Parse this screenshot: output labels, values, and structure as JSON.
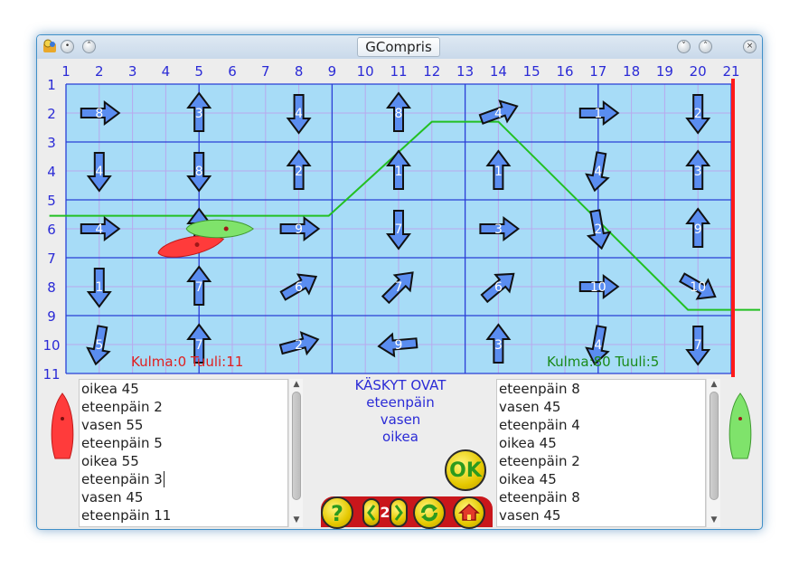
{
  "window": {
    "title": "GCompris"
  },
  "colors": {
    "sea": "#a7dcf7",
    "grid_major": "#2a3fd6",
    "grid_minor": "#b8a9ee",
    "arrow_fill": "#5a8df0",
    "axis_label": "#2b2bd6",
    "finish_line": "#ff1b1b",
    "boat_red": "#ff3b3b",
    "boat_green": "#7fe36b",
    "track_green": "#22c022",
    "text_red": "#e02020",
    "text_green": "#1a8a1a"
  },
  "board": {
    "x_labels": [
      "1",
      "2",
      "3",
      "4",
      "5",
      "6",
      "7",
      "8",
      "9",
      "10",
      "11",
      "12",
      "13",
      "14",
      "15",
      "16",
      "17",
      "18",
      "19",
      "20",
      "21"
    ],
    "y_labels": [
      "1",
      "2",
      "3",
      "4",
      "5",
      "6",
      "7",
      "8",
      "9",
      "10",
      "11"
    ],
    "arrows": [
      {
        "label": "8",
        "dir": 90,
        "col": 2,
        "row": 2
      },
      {
        "label": "3",
        "dir": 0,
        "col": 5,
        "row": 2
      },
      {
        "label": "4",
        "dir": 180,
        "col": 8,
        "row": 2
      },
      {
        "label": "8",
        "dir": 0,
        "col": 11,
        "row": 2
      },
      {
        "label": "4",
        "dir": 70,
        "col": 14,
        "row": 2
      },
      {
        "label": "1",
        "dir": 90,
        "col": 17,
        "row": 2
      },
      {
        "label": "2",
        "dir": 180,
        "col": 20,
        "row": 2
      },
      {
        "label": "4",
        "dir": 180,
        "col": 2,
        "row": 4
      },
      {
        "label": "8",
        "dir": 180,
        "col": 5,
        "row": 4
      },
      {
        "label": "2",
        "dir": 0,
        "col": 8,
        "row": 4
      },
      {
        "label": "1",
        "dir": 0,
        "col": 11,
        "row": 4
      },
      {
        "label": "1",
        "dir": 0,
        "col": 14,
        "row": 4
      },
      {
        "label": "4",
        "dir": 190,
        "col": 17,
        "row": 4
      },
      {
        "label": "3",
        "dir": 0,
        "col": 20,
        "row": 4
      },
      {
        "label": "4",
        "dir": 90,
        "col": 2,
        "row": 6
      },
      {
        "label": "5",
        "dir": 0,
        "col": 5,
        "row": 6
      },
      {
        "label": "9",
        "dir": 90,
        "col": 8,
        "row": 6
      },
      {
        "label": "7",
        "dir": 180,
        "col": 11,
        "row": 6
      },
      {
        "label": "3",
        "dir": 90,
        "col": 14,
        "row": 6
      },
      {
        "label": "2",
        "dir": 170,
        "col": 17,
        "row": 6
      },
      {
        "label": "9",
        "dir": 0,
        "col": 20,
        "row": 6
      },
      {
        "label": "1",
        "dir": 180,
        "col": 2,
        "row": 8
      },
      {
        "label": "7",
        "dir": 0,
        "col": 5,
        "row": 8
      },
      {
        "label": "6",
        "dir": 60,
        "col": 8,
        "row": 8
      },
      {
        "label": "7",
        "dir": 45,
        "col": 11,
        "row": 8
      },
      {
        "label": "6",
        "dir": 50,
        "col": 14,
        "row": 8
      },
      {
        "label": "10",
        "dir": 90,
        "col": 17,
        "row": 8
      },
      {
        "label": "10",
        "dir": 120,
        "col": 20,
        "row": 8
      },
      {
        "label": "5",
        "dir": 190,
        "col": 2,
        "row": 10
      },
      {
        "label": "7",
        "dir": 0,
        "col": 5,
        "row": 10
      },
      {
        "label": "2",
        "dir": 75,
        "col": 8,
        "row": 10
      },
      {
        "label": "9",
        "dir": 265,
        "col": 11,
        "row": 10
      },
      {
        "label": "3",
        "dir": 0,
        "col": 14,
        "row": 10
      },
      {
        "label": "4",
        "dir": 190,
        "col": 17,
        "row": 10
      },
      {
        "label": "7",
        "dir": 180,
        "col": 20,
        "row": 10
      }
    ],
    "track": [
      [
        0.5,
        5.55
      ],
      [
        8.9,
        5.55
      ],
      [
        12,
        2.3
      ],
      [
        14,
        2.3
      ],
      [
        19.7,
        8.8
      ],
      [
        22,
        8.8
      ]
    ],
    "red_status": "Kulma:0 Tuuli:11",
    "green_status": "Kulma:80 Tuuli:5"
  },
  "left_program": {
    "lines": [
      "oikea 45",
      "eteenpäin 2",
      "vasen 55",
      "eteenpäin 5",
      "oikea 55",
      "eteenpäin 3",
      "vasen 45",
      "eteenpäin 11"
    ]
  },
  "right_program": {
    "lines": [
      "eteenpäin 8",
      "vasen 45",
      "eteenpäin 4",
      "oikea 45",
      "eteenpäin 2",
      "oikea 45",
      "eteenpäin 8",
      "vasen 45"
    ]
  },
  "commands": {
    "title": "KÄSKYT OVAT",
    "items": [
      "eteenpäin",
      "vasen",
      "oikea"
    ]
  },
  "buttons": {
    "ok_label": "OK",
    "help_label": "?",
    "level": "2"
  },
  "icons": {
    "help": "help-icon",
    "level_prev": "chevron-left-icon",
    "level_next": "chevron-right-icon",
    "reload": "reload-icon",
    "home": "home-icon",
    "ok": "ok-icon"
  }
}
